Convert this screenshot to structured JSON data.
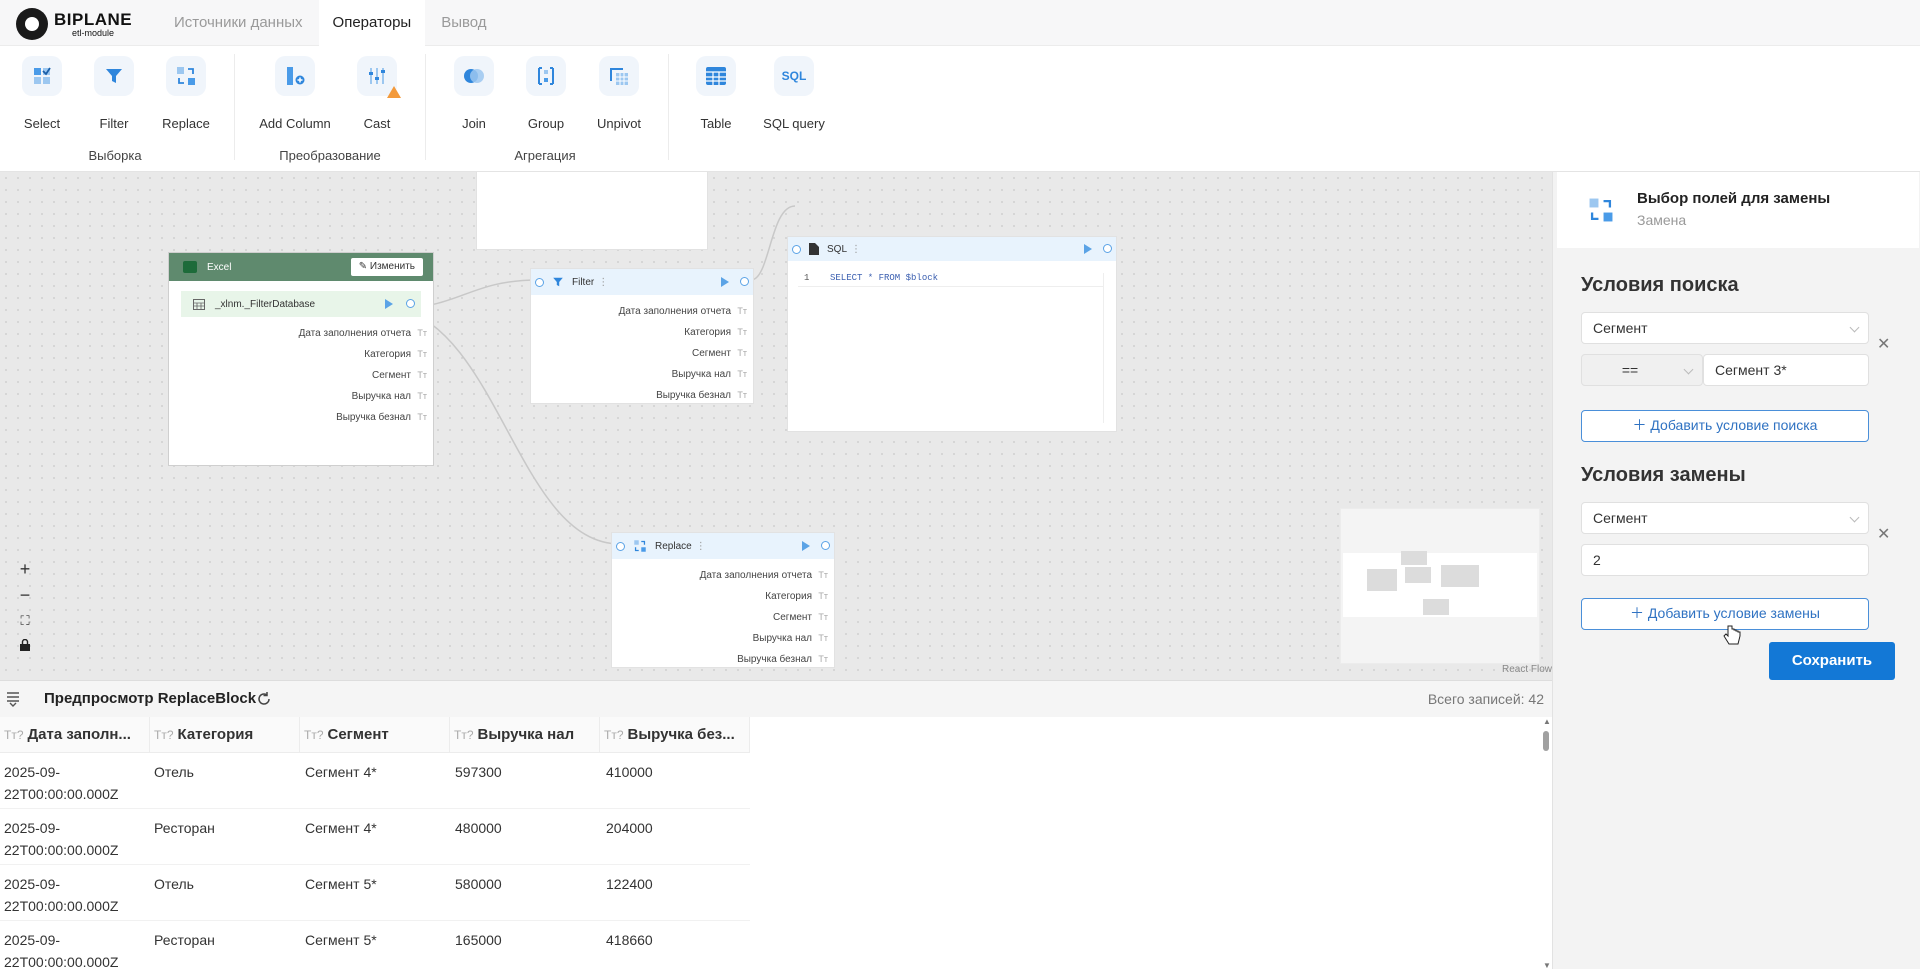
{
  "brand": {
    "name": "BIPLANE",
    "sub": "etl-module"
  },
  "tabs": [
    {
      "label": "Источники данных"
    },
    {
      "label": "Операторы"
    },
    {
      "label": "Вывод"
    }
  ],
  "toolbar": {
    "tools": [
      {
        "label": "Select"
      },
      {
        "label": "Filter"
      },
      {
        "label": "Replace"
      },
      {
        "label": "Add Column"
      },
      {
        "label": "Cast"
      },
      {
        "label": "Join"
      },
      {
        "label": "Group"
      },
      {
        "label": "Unpivot"
      },
      {
        "label": "Table"
      },
      {
        "label": "SQL query"
      }
    ],
    "groups": [
      {
        "label": "Выборка"
      },
      {
        "label": "Преобразование"
      },
      {
        "label": "Агрегация"
      }
    ]
  },
  "nodes": {
    "excel": {
      "title": "Excel",
      "edit_label": "Изменить",
      "table": "_xlnm._FilterDatabase"
    },
    "filter": {
      "title": "Filter"
    },
    "sql": {
      "title": "SQL",
      "line_no": "1",
      "query": "SELECT * FROM $block"
    },
    "replace": {
      "title": "Replace"
    },
    "fields": [
      "Дата заполнения отчета",
      "Категория",
      "Сегмент",
      "Выручка нал",
      "Выручка безнал"
    ],
    "field_type": "Tт"
  },
  "canvas": {
    "attribution": "React Flow"
  },
  "panel": {
    "title": "Выбор полей для замены",
    "subtitle": "Замена",
    "search_heading": "Условия поиска",
    "search_field": "Сегмент",
    "search_operator": "==",
    "search_value": "Сегмент 3*",
    "add_search": "Добавить условие поиска",
    "replace_heading": "Условия замены",
    "replace_field": "Сегмент",
    "replace_value": "2",
    "add_replace": "Добавить условие замены",
    "save": "Сохранить"
  },
  "preview": {
    "title": "Предпросмотр ReplaceBlock",
    "total": "Всего записей: 42",
    "type_icon": "Tт?",
    "columns": [
      "Дата заполн...",
      "Категория",
      "Сегмент",
      "Выручка нал",
      "Выручка без..."
    ],
    "rows": [
      {
        "date1": "2025-09-",
        "date2": "22T00:00:00.000Z",
        "cat": "Отель",
        "seg": "Сегмент 4*",
        "cash": "597300",
        "card": "410000"
      },
      {
        "date1": "2025-09-",
        "date2": "22T00:00:00.000Z",
        "cat": "Ресторан",
        "seg": "Сегмент 4*",
        "cash": "480000",
        "card": "204000"
      },
      {
        "date1": "2025-09-",
        "date2": "22T00:00:00.000Z",
        "cat": "Отель",
        "seg": "Сегмент 5*",
        "cash": "580000",
        "card": "122400"
      },
      {
        "date1": "2025-09-",
        "date2": "22T00:00:00.000Z",
        "cat": "Ресторан",
        "seg": "Сегмент 5*",
        "cash": "165000",
        "card": "418660"
      }
    ]
  },
  "colors": {
    "accent": "#1378d6",
    "node_header": "#e8f3fd",
    "excel_header": "#5f8a6e"
  }
}
